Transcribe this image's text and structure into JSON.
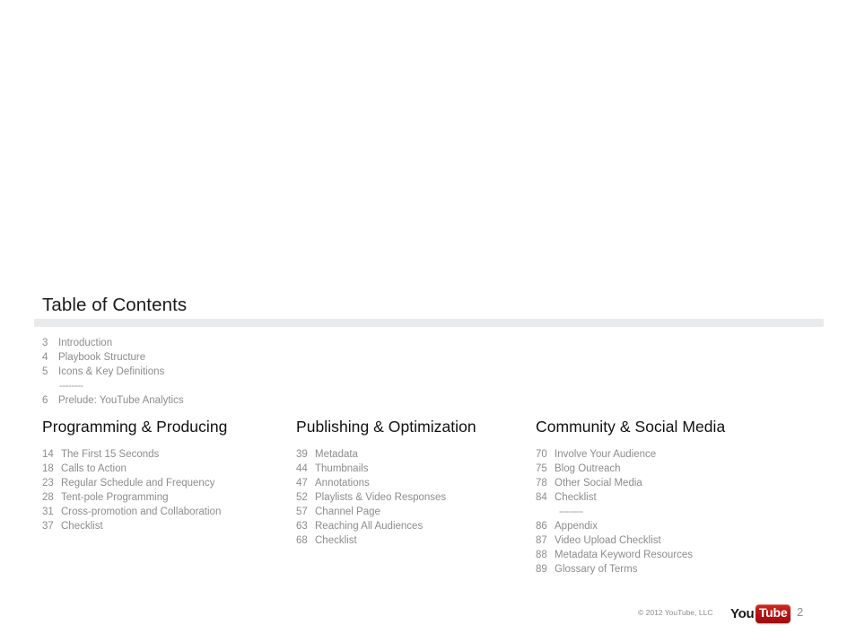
{
  "slide": {
    "title": "Table of Contents",
    "separator_dashes": "--------"
  },
  "front_matter": {
    "entries": [
      {
        "page": "3",
        "label": "Introduction"
      },
      {
        "page": "4",
        "label": "Playbook Structure"
      },
      {
        "page": "5",
        "label": "Icons & Key Definitions"
      },
      {
        "page": "",
        "label": "--------",
        "separator": true
      },
      {
        "page": "6",
        "label": "Prelude: YouTube Analytics"
      }
    ]
  },
  "columns": [
    {
      "heading": "Programming & Producing",
      "entries": [
        {
          "page": "14",
          "label": "The First 15 Seconds"
        },
        {
          "page": "18",
          "label": "Calls to Action"
        },
        {
          "page": "23",
          "label": "Regular Schedule and Frequency"
        },
        {
          "page": "28",
          "label": "Tent-pole Programming"
        },
        {
          "page": "31",
          "label": "Cross-promotion and Collaboration"
        },
        {
          "page": "37",
          "label": "Checklist"
        }
      ]
    },
    {
      "heading": "Publishing & Optimization",
      "entries": [
        {
          "page": "39",
          "label": "Metadata"
        },
        {
          "page": "44",
          "label": "Thumbnails"
        },
        {
          "page": "47",
          "label": "Annotations"
        },
        {
          "page": "52",
          "label": "Playlists & Video Responses"
        },
        {
          "page": "57",
          "label": "Channel Page"
        },
        {
          "page": "63",
          "label": "Reaching All Audiences"
        },
        {
          "page": "68",
          "label": "Checklist"
        }
      ]
    },
    {
      "heading": "Community & Social Media",
      "entries": [
        {
          "page": "70",
          "label": "Involve Your Audience"
        },
        {
          "page": "75",
          "label": "Blog Outreach"
        },
        {
          "page": "78",
          "label": "Other Social Media"
        },
        {
          "page": "84",
          "label": "Checklist"
        },
        {
          "page": "",
          "label": "--------",
          "separator": true
        },
        {
          "page": "86",
          "label": "Appendix"
        },
        {
          "page": "87",
          "label": "Video Upload Checklist"
        },
        {
          "page": "88",
          "label": "Metadata Keyword Resources"
        },
        {
          "page": "89",
          "label": "Glossary of Terms"
        }
      ]
    }
  ],
  "footer": {
    "copyright": "© 2012 YouTube, LLC",
    "page_number": "2",
    "logo": {
      "word_dark": "You",
      "word_light": "Tube",
      "red": "#b31217"
    }
  },
  "colors": {
    "divider_bar": "#e9eaec",
    "entry_text": "#8c8c8c",
    "heading_text": "#111111",
    "title_text": "#1a1a1a"
  }
}
